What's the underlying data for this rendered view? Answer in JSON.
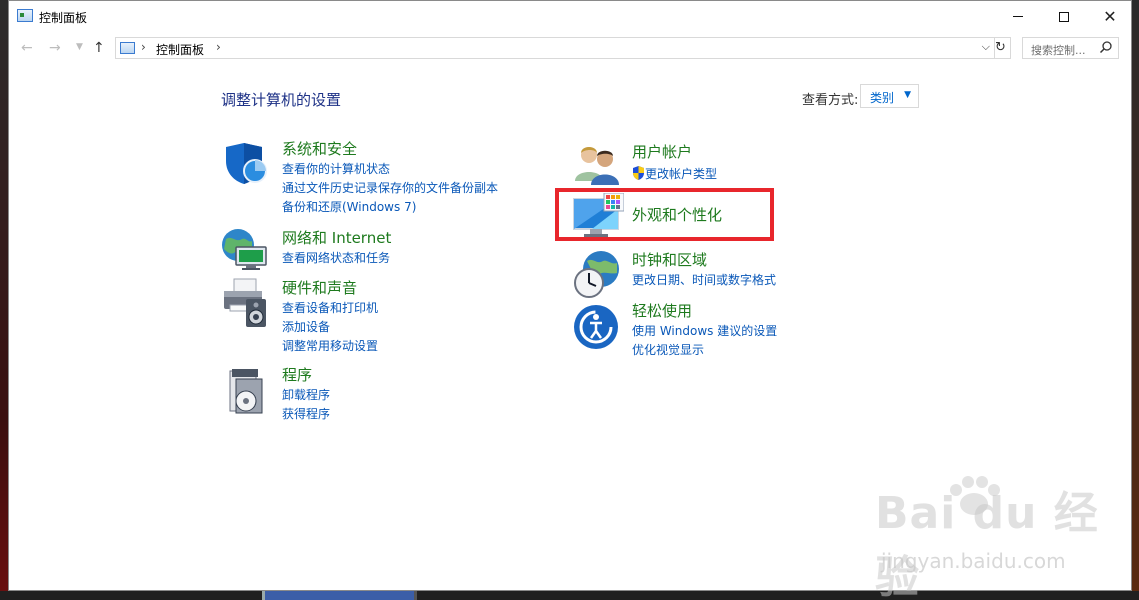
{
  "window": {
    "title": "控制面板",
    "controls": {
      "minimize": "minimize",
      "maximize": "maximize",
      "close": "✕"
    }
  },
  "nav": {
    "back": "←",
    "forward": "→",
    "recent": "⌄",
    "up": "↑",
    "separator": "›",
    "breadcrumb": "控制面板",
    "dropdown": "⌵",
    "refresh": "↻",
    "search_placeholder": "搜索控制...",
    "search_icon": "⌕"
  },
  "main": {
    "heading": "调整计算机的设置",
    "view_by_label": "查看方式:",
    "view_by_value": "类别",
    "view_by_arrow": "▼"
  },
  "categories_left": [
    {
      "title": "系统和安全",
      "icon": "shield-icon",
      "links": [
        "查看你的计算机状态",
        "通过文件历史记录保存你的文件备份副本",
        "备份和还原(Windows 7)"
      ]
    },
    {
      "title": "网络和 Internet",
      "icon": "network-globe-icon",
      "links": [
        "查看网络状态和任务"
      ]
    },
    {
      "title": "硬件和声音",
      "icon": "printer-speaker-icon",
      "links": [
        "查看设备和打印机",
        "添加设备",
        "调整常用移动设置"
      ]
    },
    {
      "title": "程序",
      "icon": "programs-disc-icon",
      "links": [
        "卸载程序",
        "获得程序"
      ]
    }
  ],
  "categories_right": [
    {
      "title": "用户帐户",
      "icon": "users-icon",
      "links": [
        "更改帐户类型"
      ]
    },
    {
      "title": "外观和个性化",
      "icon": "monitor-palette-icon",
      "links": []
    },
    {
      "title": "时钟和区域",
      "icon": "clock-globe-icon",
      "links": [
        "更改日期、时间或数字格式"
      ]
    },
    {
      "title": "轻松使用",
      "icon": "ease-of-access-icon",
      "links": [
        "使用 Windows 建议的设置",
        "优化视觉显示"
      ]
    }
  ],
  "watermark": {
    "brand": "Bai du 经验",
    "url": "jingyan.baidu.com"
  },
  "colors": {
    "category_title": "#1e7a1e",
    "link": "#0a58b8",
    "heading": "#1e3287",
    "highlight": "#e8262c"
  }
}
